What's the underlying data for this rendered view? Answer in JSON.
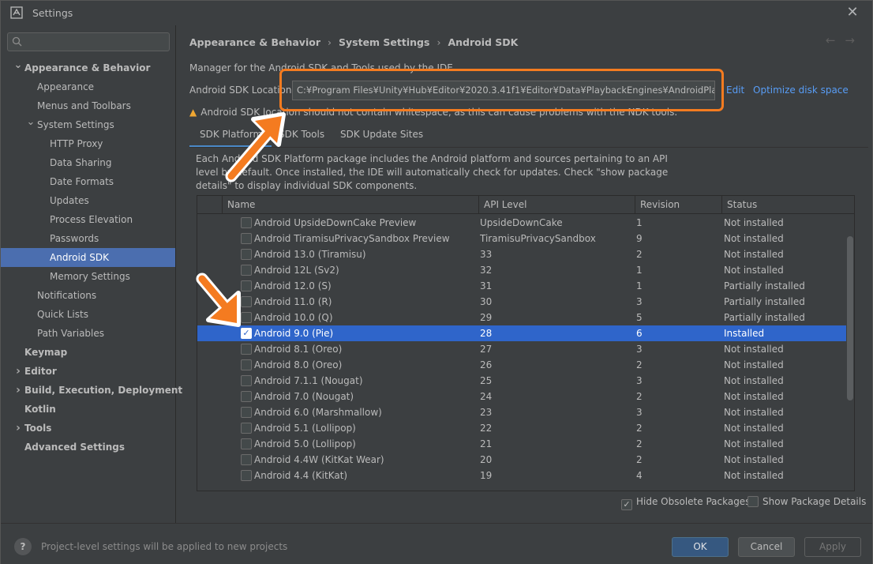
{
  "window": {
    "title": "Settings"
  },
  "search": {
    "placeholder": ""
  },
  "sidebar": {
    "items": [
      {
        "label": "Appearance & Behavior",
        "bold": true,
        "chevron": "down"
      },
      {
        "label": "Appearance",
        "bold": false
      },
      {
        "label": "Menus and Toolbars",
        "bold": false
      },
      {
        "label": "System Settings",
        "bold": false,
        "chevron": "down"
      },
      {
        "label": "HTTP Proxy",
        "bold": false
      },
      {
        "label": "Data Sharing",
        "bold": false
      },
      {
        "label": "Date Formats",
        "bold": false
      },
      {
        "label": "Updates",
        "bold": false
      },
      {
        "label": "Process Elevation",
        "bold": false
      },
      {
        "label": "Passwords",
        "bold": false
      },
      {
        "label": "Android SDK",
        "bold": false,
        "selected": true
      },
      {
        "label": "Memory Settings",
        "bold": false
      },
      {
        "label": "Notifications",
        "bold": false
      },
      {
        "label": "Quick Lists",
        "bold": false
      },
      {
        "label": "Path Variables",
        "bold": false
      },
      {
        "label": "Keymap",
        "bold": true
      },
      {
        "label": "Editor",
        "bold": true,
        "chevron": "right"
      },
      {
        "label": "Build, Execution, Deployment",
        "bold": true,
        "chevron": "right"
      },
      {
        "label": "Kotlin",
        "bold": true
      },
      {
        "label": "Tools",
        "bold": true,
        "chevron": "right"
      },
      {
        "label": "Advanced Settings",
        "bold": true
      }
    ]
  },
  "breadcrumb": {
    "part1": "Appearance & Behavior",
    "part2": "System Settings",
    "part3": "Android SDK",
    "sep": "›"
  },
  "nav": {
    "back": "←",
    "forward": "→"
  },
  "main": {
    "manager_text": "Manager for the Android SDK and Tools used by the IDE",
    "sdk_location_label": "Android SDK Location:",
    "sdk_location_value": "C:¥Program Files¥Unity¥Hub¥Editor¥2020.3.41f1¥Editor¥Data¥PlaybackEngines¥AndroidPlayer¥SDK",
    "edit_link": "Edit",
    "optimize_link": "Optimize disk space",
    "warning": "Android SDK location should not contain whitespace, as this can cause problems with the NDK tools.",
    "tabs": [
      "SDK Platforms",
      "SDK Tools",
      "SDK Update Sites"
    ],
    "description": "Each Android SDK Platform package includes the Android platform and sources pertaining to an API level by default. Once installed, the IDE will automatically check for updates. Check \"show package details\" to display individual SDK components."
  },
  "table": {
    "columns": [
      "Name",
      "API Level",
      "Revision",
      "Status"
    ],
    "rows": [
      {
        "name": "Android UpsideDownCake Preview",
        "api": "UpsideDownCake",
        "rev": "1",
        "status": "Not installed",
        "checked": false
      },
      {
        "name": "Android TiramisuPrivacySandbox Preview",
        "api": "TiramisuPrivacySandbox",
        "rev": "9",
        "status": "Not installed",
        "checked": false
      },
      {
        "name": "Android 13.0 (Tiramisu)",
        "api": "33",
        "rev": "2",
        "status": "Not installed",
        "checked": false
      },
      {
        "name": "Android 12L (Sv2)",
        "api": "32",
        "rev": "1",
        "status": "Not installed",
        "checked": false
      },
      {
        "name": "Android 12.0 (S)",
        "api": "31",
        "rev": "1",
        "status": "Partially installed",
        "checked": false
      },
      {
        "name": "Android 11.0 (R)",
        "api": "30",
        "rev": "3",
        "status": "Partially installed",
        "checked": false
      },
      {
        "name": "Android 10.0 (Q)",
        "api": "29",
        "rev": "5",
        "status": "Partially installed",
        "checked": false
      },
      {
        "name": "Android 9.0 (Pie)",
        "api": "28",
        "rev": "6",
        "status": "Installed",
        "checked": true,
        "selected": true
      },
      {
        "name": "Android 8.1 (Oreo)",
        "api": "27",
        "rev": "3",
        "status": "Not installed",
        "checked": false
      },
      {
        "name": "Android 8.0 (Oreo)",
        "api": "26",
        "rev": "2",
        "status": "Not installed",
        "checked": false
      },
      {
        "name": "Android 7.1.1 (Nougat)",
        "api": "25",
        "rev": "3",
        "status": "Not installed",
        "checked": false
      },
      {
        "name": "Android 7.0 (Nougat)",
        "api": "24",
        "rev": "2",
        "status": "Not installed",
        "checked": false
      },
      {
        "name": "Android 6.0 (Marshmallow)",
        "api": "23",
        "rev": "3",
        "status": "Not installed",
        "checked": false
      },
      {
        "name": "Android 5.1 (Lollipop)",
        "api": "22",
        "rev": "2",
        "status": "Not installed",
        "checked": false
      },
      {
        "name": "Android 5.0 (Lollipop)",
        "api": "21",
        "rev": "2",
        "status": "Not installed",
        "checked": false
      },
      {
        "name": "Android 4.4W (KitKat Wear)",
        "api": "20",
        "rev": "2",
        "status": "Not installed",
        "checked": false
      },
      {
        "name": "Android 4.4 (KitKat)",
        "api": "19",
        "rev": "4",
        "status": "Not installed",
        "checked": false
      }
    ]
  },
  "options": {
    "hide_obsolete": "Hide Obsolete Packages",
    "hide_obsolete_checked": true,
    "show_details": "Show Package Details",
    "show_details_checked": false
  },
  "footer": {
    "help": "?",
    "text": "Project-level settings will be applied to new projects",
    "ok": "OK",
    "cancel": "Cancel",
    "apply": "Apply"
  },
  "colors": {
    "accent": "#4b6eaf",
    "selection": "#2f65ca",
    "link": "#589df6",
    "annotation": "#f47b20",
    "warning": "#f0a732"
  }
}
